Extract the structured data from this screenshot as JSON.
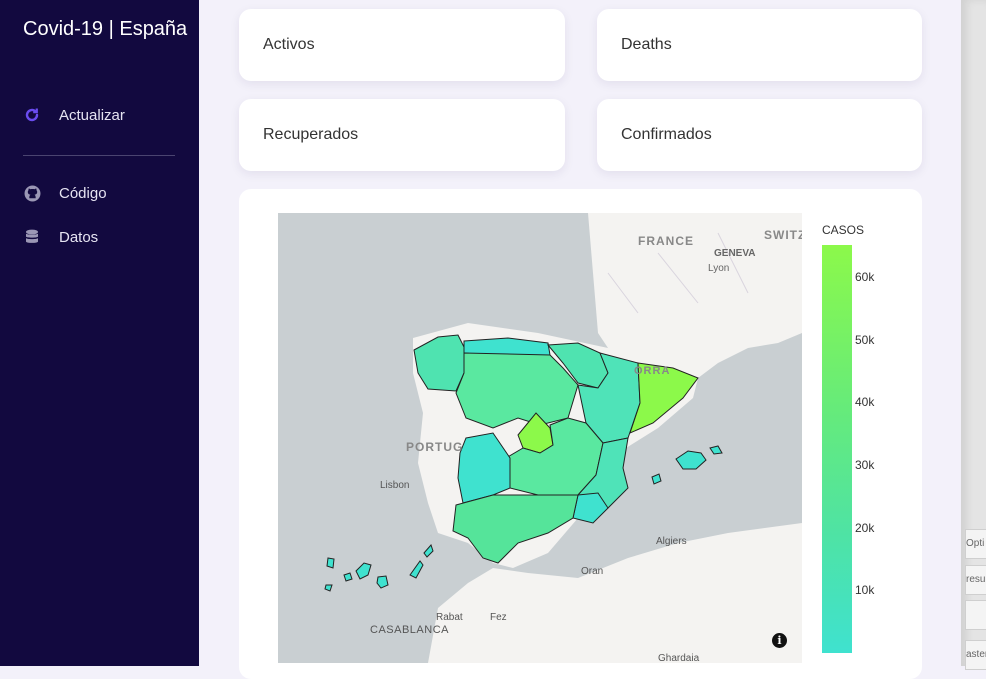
{
  "sidebar": {
    "title": "Covid-19 | España",
    "items": [
      {
        "label": "Actualizar",
        "icon": "refresh-icon"
      },
      {
        "label": "Código",
        "icon": "github-icon"
      },
      {
        "label": "Datos",
        "icon": "database-icon"
      }
    ]
  },
  "cards": {
    "activos": "Activos",
    "deaths": "Deaths",
    "recuperados": "Recuperados",
    "confirmados": "Confirmados"
  },
  "map": {
    "colorbar_title": "CASOS",
    "colorbar_ticks": [
      "60k",
      "50k",
      "40k",
      "30k",
      "20k",
      "10k"
    ],
    "labels": {
      "france": "FRANCE",
      "switz": "SWITZ",
      "geneva": "GENEVA",
      "lyon": "Lyon",
      "andorra": "ORRA",
      "portugal": "PORTUG",
      "lisbon": "Lisbon",
      "algiers": "Algiers",
      "oran": "Oran",
      "rabat": "Rabat",
      "fez": "Fez",
      "casablanca": "CASABLANCA",
      "ghardaia": "Ghardaia"
    },
    "colors": {
      "max": "#8cf94a",
      "high": "#66eb7a",
      "mid": "#55e49a",
      "low": "#3fe2cf"
    },
    "info_icon": "i"
  },
  "edge": {
    "frag1": "Opti",
    "frag2": "resul",
    "frag3": "aster"
  }
}
